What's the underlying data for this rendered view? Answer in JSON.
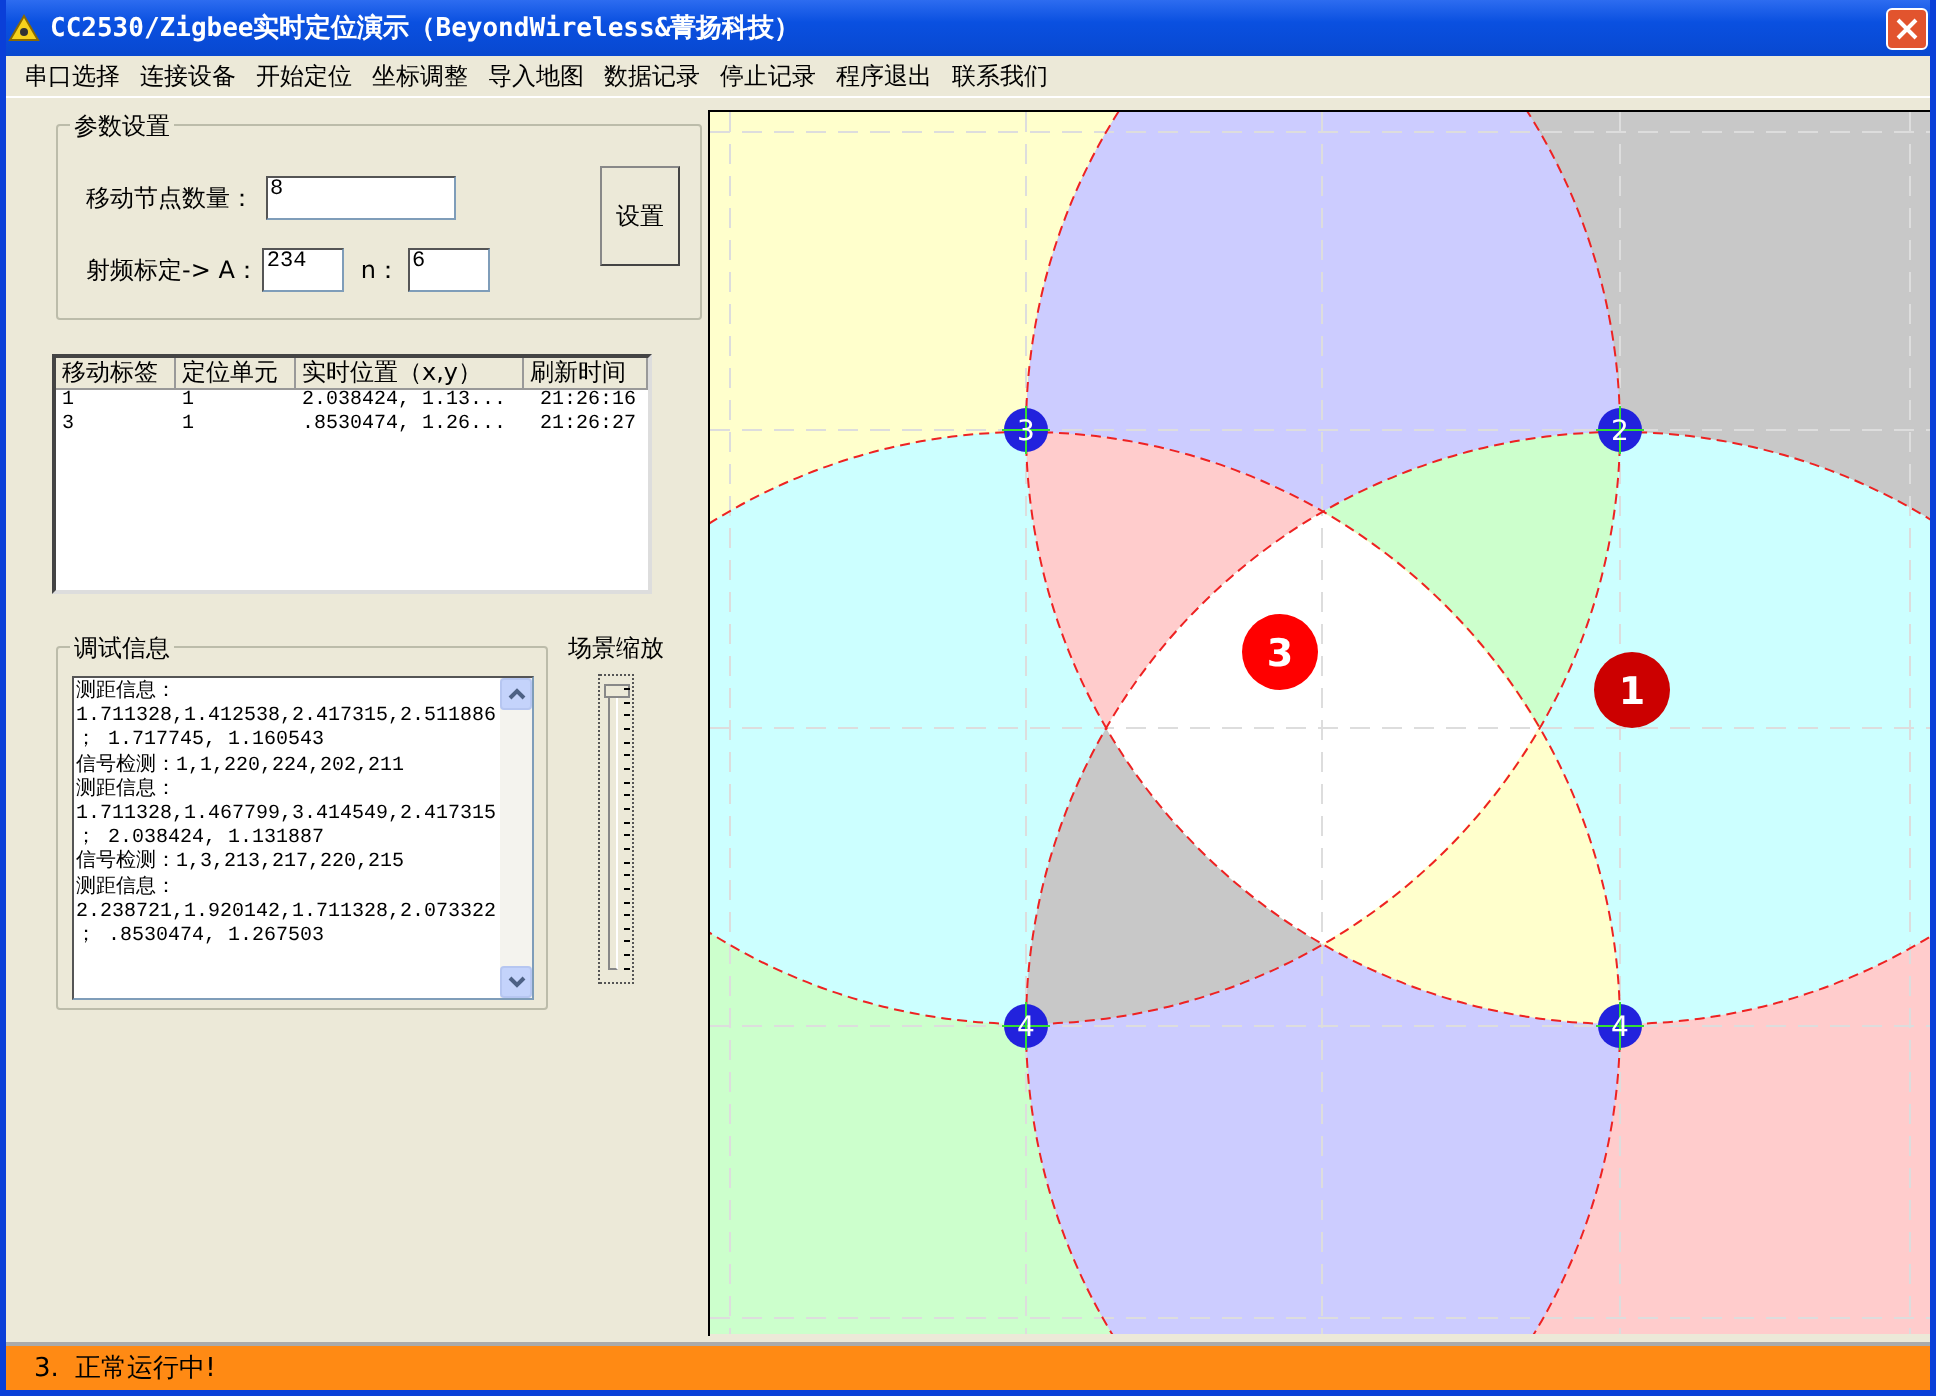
{
  "window": {
    "title": "CC2530/Zigbee实时定位演示（BeyondWireless&菁扬科技）"
  },
  "menu": [
    "串口选择",
    "连接设备",
    "开始定位",
    "坐标调整",
    "导入地图",
    "数据记录",
    "停止记录",
    "程序退出",
    "联系我们"
  ],
  "params": {
    "title": "参数设置",
    "count_label": "移动节点数量：",
    "count_value": "8",
    "rf_label": "射频标定-> A：",
    "a_value": "234",
    "n_label": "n：",
    "n_value": "6",
    "set_button": "设置"
  },
  "table": {
    "columns": [
      "移动标签",
      "定位单元",
      "实时位置（x,y）",
      "刷新时间"
    ],
    "rows": [
      [
        "1",
        "1",
        "2.038424, 1.13...",
        "21:26:16"
      ],
      [
        "3",
        "1",
        ".8530474, 1.26...",
        "21:26:27"
      ]
    ]
  },
  "debug": {
    "title": "调试信息",
    "lines": [
      "测距信息：",
      "1.711328,1.412538,2.417315,2.511886",
      "； 1.717745, 1.160543",
      "信号检测：1,1,220,224,202,211",
      "测距信息：",
      "1.711328,1.467799,3.414549,2.417315",
      "； 2.038424, 1.131887",
      "信号检测：1,3,213,217,220,215",
      "测距信息：",
      "2.238721,1.920142,1.711328,2.073322",
      "； .8530474, 1.267503"
    ]
  },
  "zoom": {
    "label": "场景缩放",
    "level": 1
  },
  "map": {
    "anchors": [
      "3",
      "2",
      "4",
      "4"
    ],
    "tags": [
      {
        "label": "3",
        "color": "#ff0000"
      },
      {
        "label": "1",
        "color": "#cc0000"
      }
    ]
  },
  "status_bar": "3.  正常运行中!"
}
